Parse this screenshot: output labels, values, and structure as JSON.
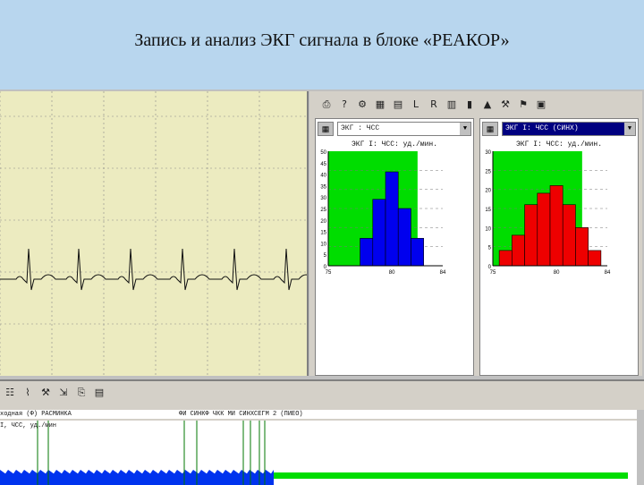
{
  "slide": {
    "title": "Запись и анализ ЭКГ сигнала в блоке «РЕАКОР»"
  },
  "toolbar_right": {
    "icons": [
      "printer-icon",
      "help-icon",
      "settings-icon",
      "table-icon",
      "grid-icon",
      "l-icon",
      "r-icon",
      "histogram-icon",
      "bars-icon",
      "chart-icon",
      "tools-icon",
      "flag-icon",
      "export-icon"
    ],
    "letters": [
      "L",
      "R"
    ]
  },
  "hist_left": {
    "combo": "ЭКГ : ЧСС",
    "title": "ЭКГ I: ЧСС: уд./мин.",
    "y_ticks": [
      "50",
      "45",
      "40",
      "35",
      "30",
      "25",
      "20",
      "15",
      "10",
      "5",
      "0"
    ],
    "x_ticks": [
      "75",
      "80",
      "84"
    ],
    "bar_color": "#0000ee",
    "bg_color": "#00dd00"
  },
  "hist_right": {
    "combo": "ЭКГ I: ЧСС (СИНХ)",
    "title": "ЭКГ I: ЧСС: уд./мин.",
    "y_ticks": [
      "30",
      "25",
      "20",
      "15",
      "10",
      "5",
      "0"
    ],
    "x_ticks": [
      "75",
      "80",
      "84"
    ],
    "bar_color": "#ee0000",
    "bg_color": "#00dd00"
  },
  "bottom": {
    "header_left": "ходная (Ф) РАСМИНКА",
    "header_mid": "ФИ СИНКФ ЧКК МИ СИНХСЕГМ 2 (ПИЕО)",
    "subheader": "I, ЧСС, уд./мин",
    "signal_color": "#0033ee",
    "event_color": "#007700",
    "baseline_color": "#00dd00"
  },
  "chart_data": [
    {
      "type": "bar",
      "title": "ЭКГ I: ЧСС: уд./мин.",
      "xlabel": "",
      "ylabel": "",
      "x": [
        78,
        79,
        80,
        81,
        82
      ],
      "values": [
        12,
        29,
        41,
        25,
        12
      ],
      "ylim": [
        0,
        50
      ],
      "xlim": [
        75,
        84
      ]
    },
    {
      "type": "bar",
      "title": "ЭКГ I: ЧСС: уд./мин.",
      "xlabel": "",
      "ylabel": "",
      "x": [
        76,
        77,
        78,
        79,
        80,
        81,
        82,
        83
      ],
      "values": [
        4,
        8,
        16,
        19,
        21,
        16,
        10,
        4
      ],
      "ylim": [
        0,
        30
      ],
      "xlim": [
        75,
        84
      ]
    }
  ]
}
